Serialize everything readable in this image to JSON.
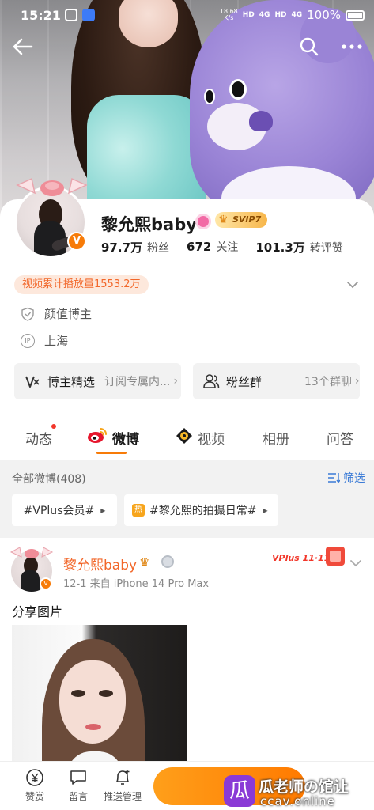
{
  "status": {
    "time": "15:21",
    "net_speed": "18.68\nK/s",
    "signal1": "HD",
    "signal1_gen": "4G",
    "signal2": "HD",
    "signal2_gen": "4G",
    "battery": "100%"
  },
  "profile": {
    "name": "黎允熙baby",
    "svip_label": "SVIP7",
    "stats": [
      {
        "value": "97.7万",
        "label": "粉丝"
      },
      {
        "value": "672",
        "label": "关注"
      },
      {
        "value": "101.3万",
        "label": "转评赞"
      }
    ],
    "play_count": "视频累计播放量1553.2万",
    "tag_category": "颜值博主",
    "ip_badge": "IP",
    "location": "上海"
  },
  "actions": {
    "featured_label": "博主精选",
    "featured_sub": "订阅专属内...",
    "fan_group_label": "粉丝群",
    "fan_group_sub": "13个群聊"
  },
  "tabs": [
    {
      "label": "动态",
      "has_dot": true
    },
    {
      "label": "微博",
      "active": true
    },
    {
      "label": "视频"
    },
    {
      "label": "相册"
    },
    {
      "label": "问答"
    }
  ],
  "filter": {
    "count_label": "全部微博(408)",
    "filter_label": "筛选"
  },
  "chips": [
    {
      "label": "#VPlus会员#"
    },
    {
      "label": "#黎允熙的拍摄日常#",
      "badge": "热"
    }
  ],
  "post": {
    "author": "黎允熙baby",
    "meta": "12-1   来自 iPhone 14 Pro Max",
    "text": "分享图片",
    "vplus_badge": "VPlus 11·11"
  },
  "bottom_bar": {
    "reward": "赞赏",
    "message": "留言",
    "push": "推送管理",
    "follow": "+"
  },
  "watermark": {
    "text": "瓜老师の馆让",
    "url": "ccav.online"
  }
}
